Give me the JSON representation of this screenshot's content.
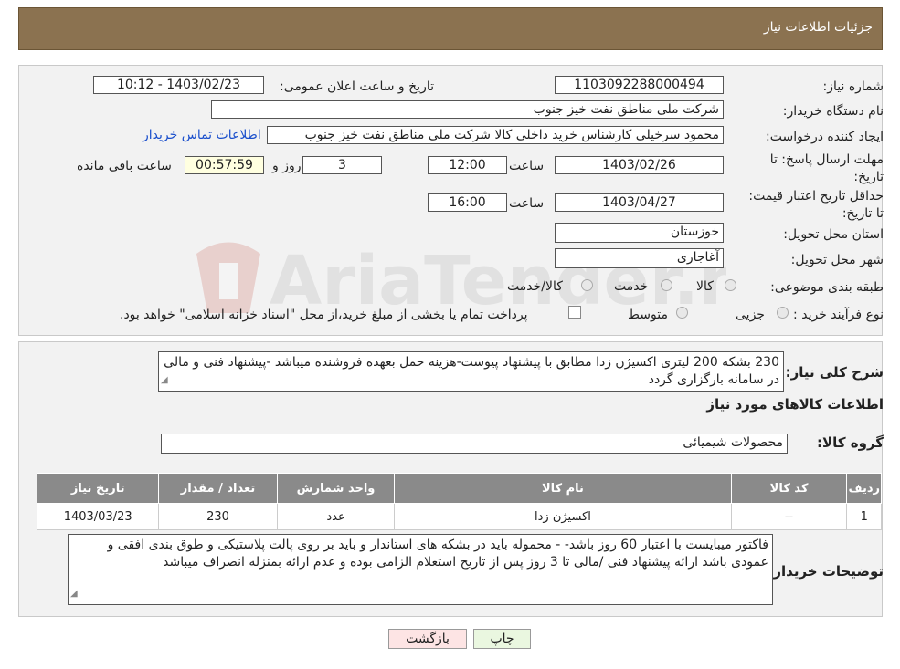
{
  "header": {
    "title": "جزئیات اطلاعات نیاز"
  },
  "form": {
    "need_number_label": "شماره نیاز:",
    "need_number": "1103092288000494",
    "announce_label": "تاریخ و ساعت اعلان عمومی:",
    "announce_value": "1403/02/23 - 10:12",
    "buyer_org_label": "نام دستگاه خریدار:",
    "buyer_org": "شرکت ملی مناطق نفت خیز جنوب",
    "creator_label": "ایجاد کننده درخواست:",
    "creator": "محمود سرخیلی کارشناس خرید داخلی کالا شرکت ملی مناطق نفت خیز جنوب",
    "contact_link": "اطلاعات تماس خریدار",
    "deadline_label": "مهلت ارسال پاسخ: تا تاریخ:",
    "deadline_date": "1403/02/26",
    "time_label": "ساعت",
    "deadline_time": "12:00",
    "days_value": "3",
    "days_label": "روز و",
    "remaining_value": "00:57:59",
    "remaining_label": "ساعت باقی مانده",
    "validity_label": "حداقل تاریخ اعتبار قیمت: تا تاریخ:",
    "validity_date": "1403/04/27",
    "validity_time": "16:00",
    "province_label": "استان محل تحویل:",
    "province": "خوزستان",
    "city_label": "شهر محل تحویل:",
    "city": "آغاجاری",
    "category_label": "طبقه بندی موضوعی:",
    "category_options": [
      "کالا",
      "خدمت",
      "کالا/خدمت"
    ],
    "process_label": "نوع فرآیند خرید :",
    "process_options": [
      "جزیی",
      "متوسط"
    ],
    "process_note": "پرداخت تمام یا بخشی از مبلغ خرید،از محل \"اسناد خزانه اسلامی\" خواهد بود."
  },
  "summary": {
    "label": "شرح کلی نیاز:",
    "text": "230 بشکه 200 لیتری  اکسیژن زدا مطابق با پیشنهاد پیوست-هزینه حمل بعهده فروشنده میباشد -پیشنهاد فنی و مالی در سامانه بارگزاری گردد",
    "items_title": "اطلاعات کالاهای مورد نیاز",
    "group_label": "گروه کالا:",
    "group_value": "محصولات شیمیائی"
  },
  "table": {
    "headers": [
      "ردیف",
      "کد کالا",
      "نام کالا",
      "واحد شمارش",
      "تعداد / مقدار",
      "تاریخ نیاز"
    ],
    "rows": [
      [
        "1",
        "--",
        "اکسیژن زدا",
        "عدد",
        "230",
        "1403/03/23"
      ]
    ]
  },
  "notes": {
    "label": "توضیحات خریدار:",
    "text": "فاکتور میبایست با اعتبار 60 روز باشد- - محموله باید در بشکه های استاندار  و باید بر روی پالت پلاستیکی و طوق بندی افقی و عمودی باشد ارائه پیشنهاد فنی /مالی تا 3 روز پس از تاریخ استعلام الزامی بوده و عدم ارائه بمنزله انصراف میباشد"
  },
  "buttons": {
    "print": "چاپ",
    "back": "بازگشت"
  },
  "watermark": "AriaTender.neT"
}
